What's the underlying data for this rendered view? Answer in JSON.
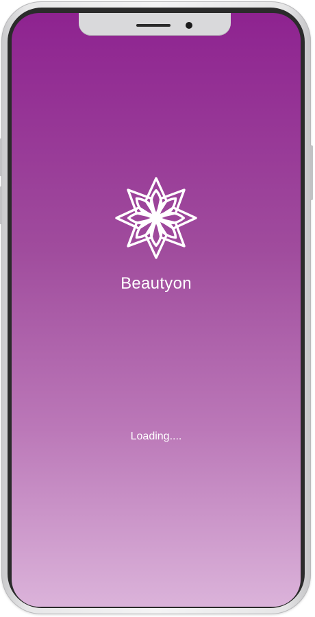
{
  "app": {
    "name": "Beautyon",
    "logo_icon": "lotus-flower-icon"
  },
  "splash": {
    "loading_text": "Loading....",
    "gradient_top": "#8e2390",
    "gradient_bottom": "#dbb3da",
    "text_color": "#ffffff"
  },
  "device": {
    "type": "smartphone-mockup",
    "frame_color": "#e7e7e8"
  }
}
